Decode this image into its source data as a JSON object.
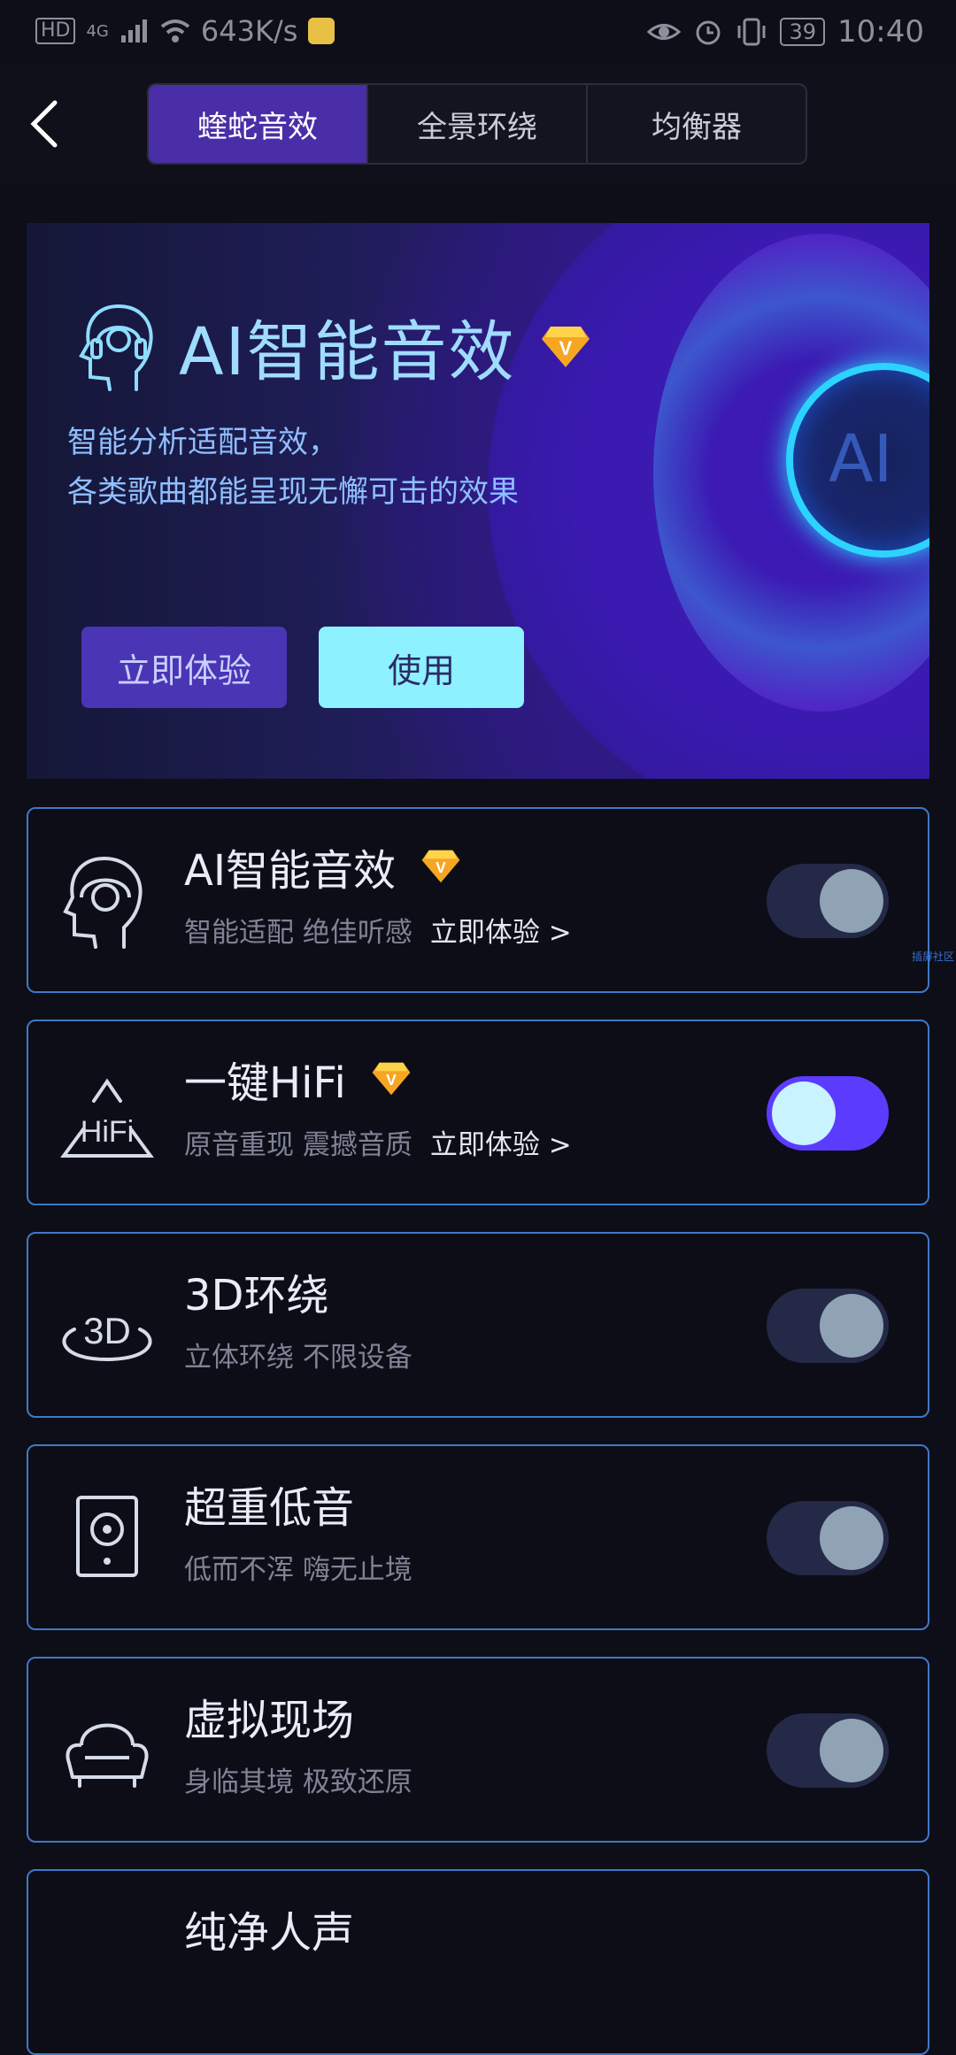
{
  "status_bar": {
    "hd_label": "HD",
    "network_label": "4G",
    "speed": "643K/s",
    "battery": "39",
    "time": "10:40"
  },
  "header": {
    "tabs": [
      {
        "label": "蝰蛇音效",
        "active": true
      },
      {
        "label": "全景环绕",
        "active": false
      },
      {
        "label": "均衡器",
        "active": false
      }
    ]
  },
  "banner": {
    "title": "AI智能音效",
    "desc_line1": "智能分析适配音效，",
    "desc_line2": "各类歌曲都能呈现无懈可击的效果",
    "orb_label": "AI",
    "try_label": "立即体验",
    "use_label": "使用"
  },
  "vip_glyph": "V",
  "cards": [
    {
      "title": "AI智能音效",
      "vip": true,
      "subtitle": "智能适配 绝佳听感",
      "link": "立即体验 >",
      "toggle_on": false,
      "icon": "ai-head-icon"
    },
    {
      "title": "一键HiFi",
      "vip": true,
      "subtitle": "原音重现 震撼音质",
      "link": "立即体验 >",
      "toggle_on": true,
      "icon": "hifi-icon",
      "icon_text": "HiFi"
    },
    {
      "title": "3D环绕",
      "vip": false,
      "subtitle": "立体环绕 不限设备",
      "link": "",
      "toggle_on": false,
      "icon": "3d-icon",
      "icon_text": "3D"
    },
    {
      "title": "超重低音",
      "vip": false,
      "subtitle": "低而不浑 嗨无止境",
      "link": "",
      "toggle_on": false,
      "icon": "speaker-icon"
    },
    {
      "title": "虚拟现场",
      "vip": false,
      "subtitle": "身临其境 极致还原",
      "link": "",
      "toggle_on": false,
      "icon": "sofa-icon"
    },
    {
      "title": "纯净人声",
      "vip": false,
      "subtitle": "",
      "link": "",
      "toggle_on": false,
      "icon": "voice-icon"
    }
  ],
  "side_watermark": "插屏社区"
}
